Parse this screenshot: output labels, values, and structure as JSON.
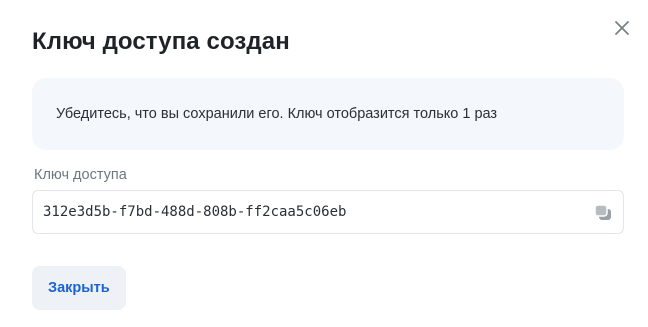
{
  "dialog": {
    "title": "Ключ доступа создан",
    "notice": "Убедитесь, что вы сохранили его. Ключ отобразится только 1 раз",
    "field_label": "Ключ доступа",
    "key_value": "312e3d5b-f7bd-488d-808b-ff2caa5c06eb",
    "close_button_label": "Закрыть",
    "icons": {
      "close": "close-icon",
      "copy": "copy-icon"
    }
  },
  "colors": {
    "accent": "#1a63d6",
    "notice_bg": "#f4f8fc",
    "button_bg": "#eef2f6"
  }
}
